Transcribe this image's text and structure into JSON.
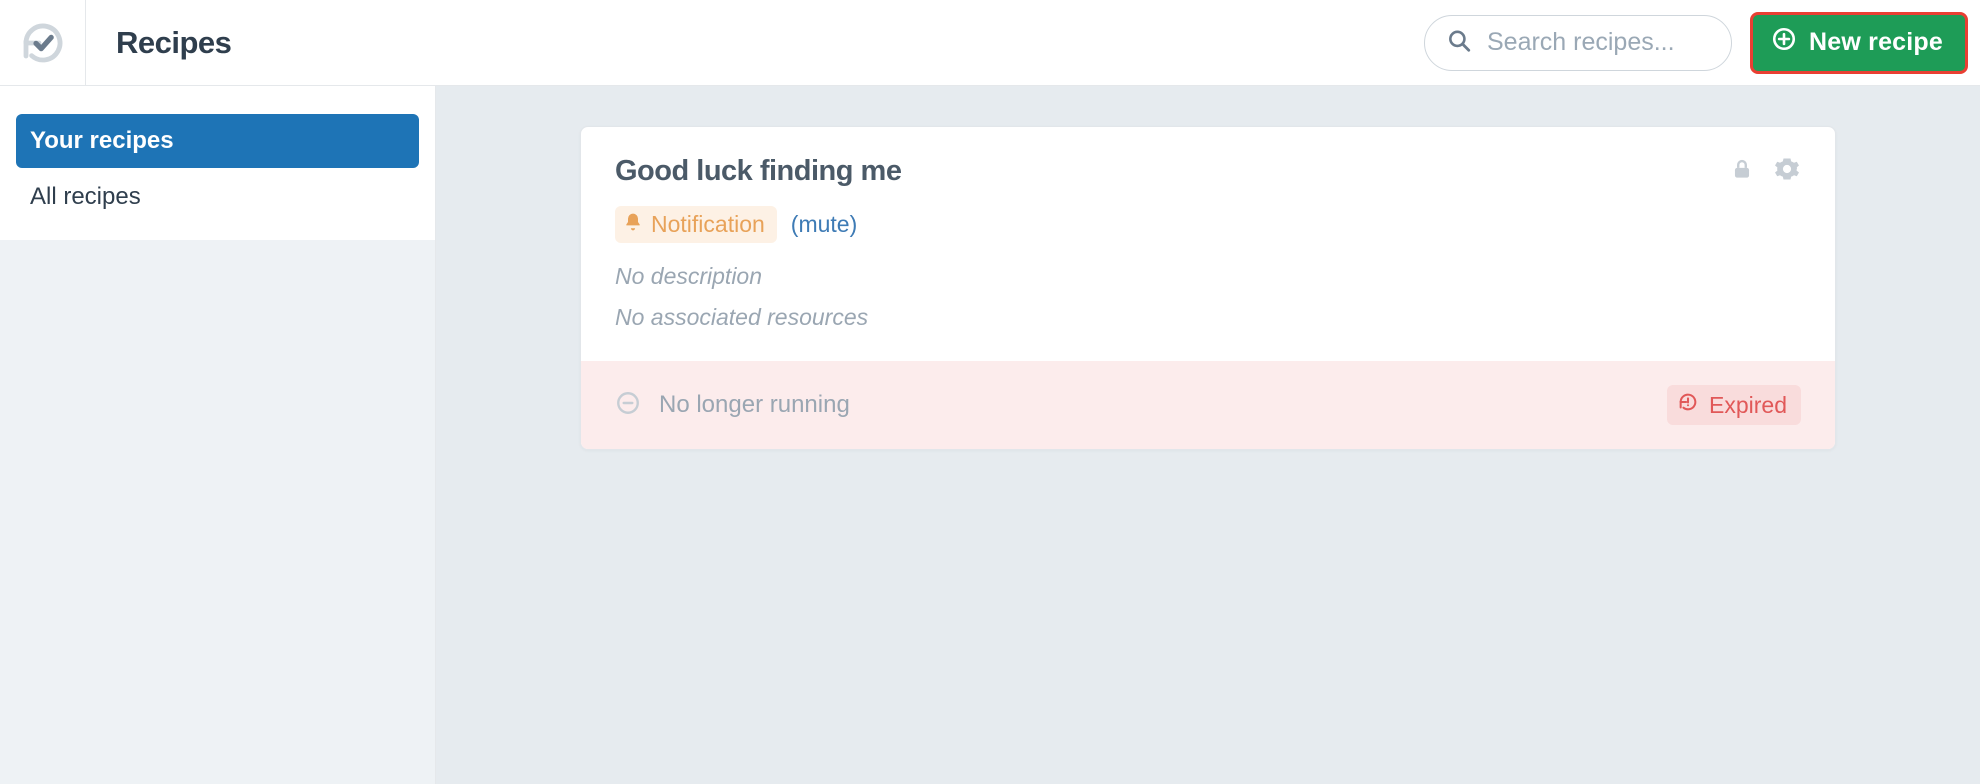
{
  "header": {
    "title": "Recipes",
    "search_placeholder": "Search recipes...",
    "new_recipe_label": "New recipe"
  },
  "sidebar": {
    "items": [
      {
        "label": "Your recipes",
        "active": true
      },
      {
        "label": "All recipes",
        "active": false
      }
    ]
  },
  "recipe": {
    "title": "Good luck finding me",
    "notification_label": "Notification",
    "mute_label": "(mute)",
    "no_description": "No description",
    "no_resources": "No associated resources",
    "status_text": "No longer running",
    "expired_label": "Expired"
  },
  "colors": {
    "primary": "#1e74b6",
    "green": "#1e9c57",
    "highlight_border": "#e93f33",
    "warn_bg": "#fdf1e5",
    "warn_fg": "#e8a259",
    "danger_bg": "#fcecec",
    "danger_badge_bg": "#f9dcdc",
    "danger_fg": "#e15858"
  }
}
